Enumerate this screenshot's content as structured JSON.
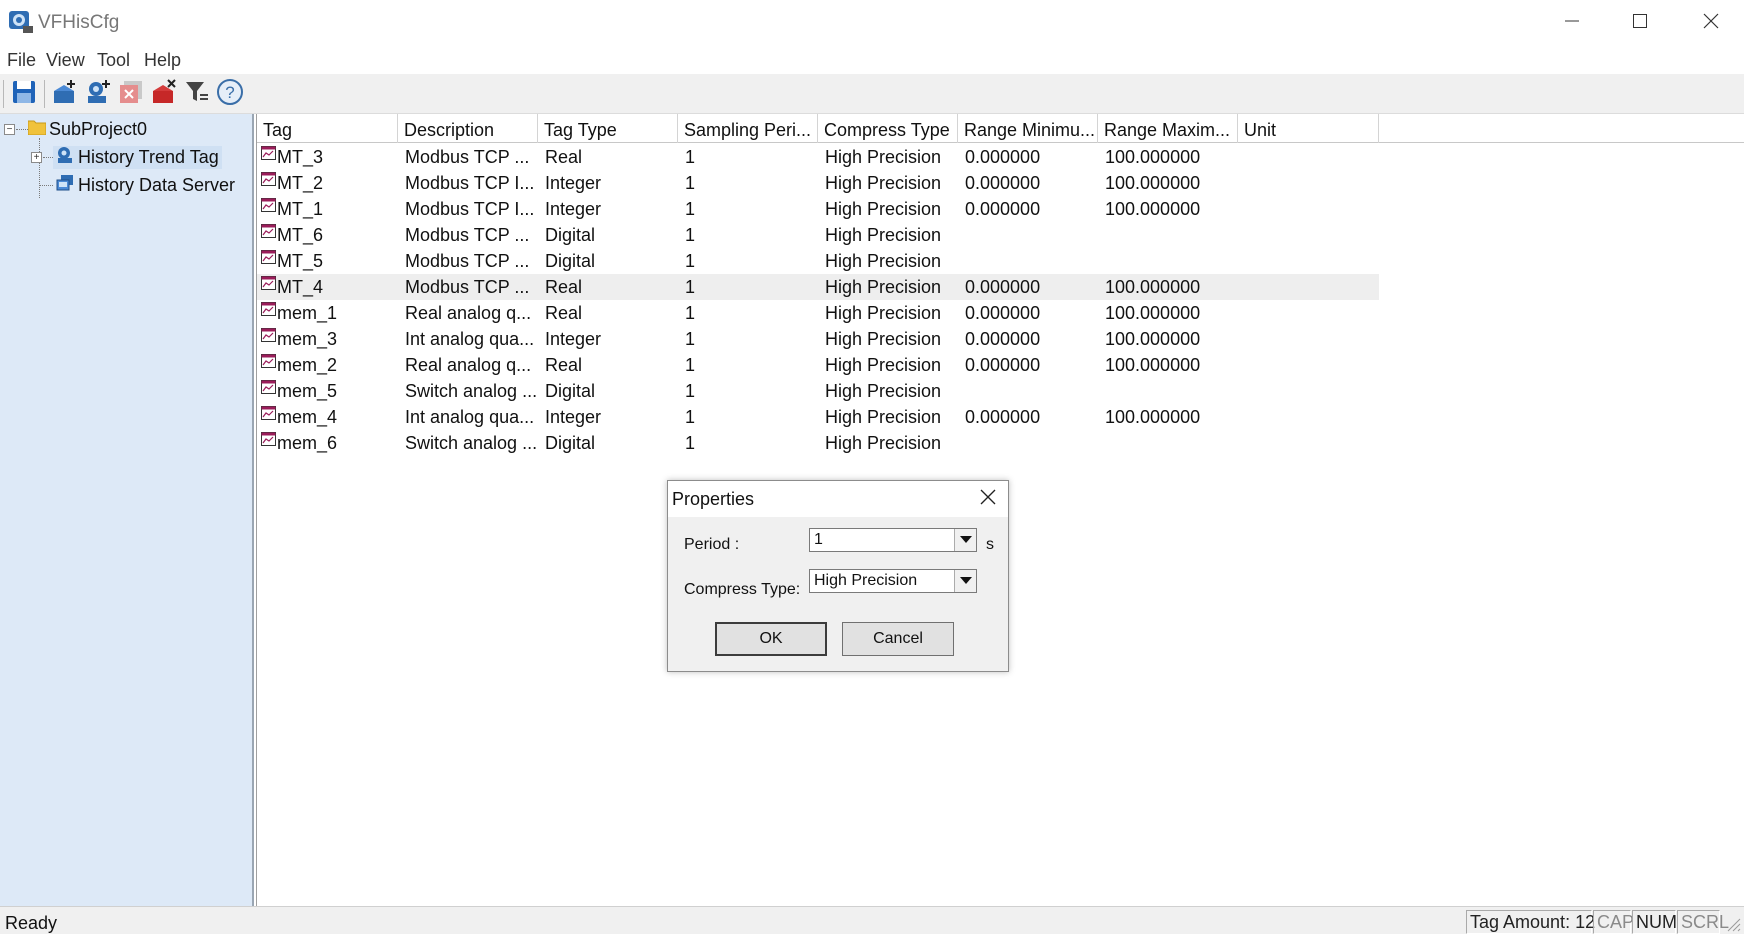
{
  "window": {
    "title": "VFHisCfg",
    "icons": [
      "app-icon",
      "minimize-icon",
      "maximize-icon",
      "close-icon"
    ]
  },
  "menu": [
    "File",
    "View",
    "Tool",
    "Help"
  ],
  "toolbar": {
    "icons": [
      "save-icon",
      "add-project-icon",
      "add-tag-icon",
      "delete-tag-icon",
      "delete-all-icon",
      "filter-icon",
      "help-icon"
    ]
  },
  "tree": {
    "root": "SubProject0",
    "children": [
      "History Trend Tag",
      "History Data Server"
    ],
    "selected": "History Trend Tag"
  },
  "list": {
    "columns": [
      "Tag",
      "Description",
      "Tag Type",
      "Sampling Peri...",
      "Compress Type",
      "Range Minimu...",
      "Range Maxim...",
      "Unit"
    ],
    "rows": [
      {
        "tag": "MT_3",
        "description": "Modbus TCP ...",
        "type": "Real",
        "period": "1",
        "compress": "High Precision",
        "min": "0.000000",
        "max": "100.000000",
        "unit": ""
      },
      {
        "tag": "MT_2",
        "description": "Modbus TCP I...",
        "type": "Integer",
        "period": "1",
        "compress": "High Precision",
        "min": "0.000000",
        "max": "100.000000",
        "unit": ""
      },
      {
        "tag": "MT_1",
        "description": "Modbus TCP I...",
        "type": "Integer",
        "period": "1",
        "compress": "High Precision",
        "min": "0.000000",
        "max": "100.000000",
        "unit": ""
      },
      {
        "tag": "MT_6",
        "description": "Modbus TCP ...",
        "type": "Digital",
        "period": "1",
        "compress": "High Precision",
        "min": "",
        "max": "",
        "unit": ""
      },
      {
        "tag": "MT_5",
        "description": "Modbus TCP ...",
        "type": "Digital",
        "period": "1",
        "compress": "High Precision",
        "min": "",
        "max": "",
        "unit": ""
      },
      {
        "tag": "MT_4",
        "description": "Modbus TCP ...",
        "type": "Real",
        "period": "1",
        "compress": "High Precision",
        "min": "0.000000",
        "max": "100.000000",
        "unit": ""
      },
      {
        "tag": "mem_1",
        "description": "Real analog q...",
        "type": "Real",
        "period": "1",
        "compress": "High Precision",
        "min": "0.000000",
        "max": "100.000000",
        "unit": ""
      },
      {
        "tag": "mem_3",
        "description": "Int analog qua...",
        "type": "Integer",
        "period": "1",
        "compress": "High Precision",
        "min": "0.000000",
        "max": "100.000000",
        "unit": ""
      },
      {
        "tag": "mem_2",
        "description": "Real analog q...",
        "type": "Real",
        "period": "1",
        "compress": "High Precision",
        "min": "0.000000",
        "max": "100.000000",
        "unit": ""
      },
      {
        "tag": "mem_5",
        "description": "Switch analog ...",
        "type": "Digital",
        "period": "1",
        "compress": "High Precision",
        "min": "",
        "max": "",
        "unit": ""
      },
      {
        "tag": "mem_4",
        "description": "Int analog qua...",
        "type": "Integer",
        "period": "1",
        "compress": "High Precision",
        "min": "0.000000",
        "max": "100.000000",
        "unit": ""
      },
      {
        "tag": "mem_6",
        "description": "Switch analog ...",
        "type": "Digital",
        "period": "1",
        "compress": "High Precision",
        "min": "",
        "max": "",
        "unit": ""
      }
    ],
    "highlighted_row": "MT_4"
  },
  "dialog": {
    "title": "Properties",
    "period_label": "Period :",
    "period_value": "1",
    "period_unit": "s",
    "compress_label": "Compress Type:",
    "compress_value": "High Precision",
    "ok_label": "OK",
    "cancel_label": "Cancel"
  },
  "status": {
    "text": "Ready",
    "tag_amount": "Tag Amount: 12",
    "cap": "CAP",
    "num": "NUM",
    "scrl": "SCRL"
  }
}
